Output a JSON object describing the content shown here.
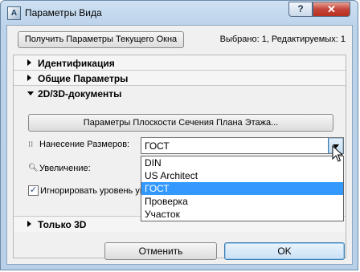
{
  "window": {
    "title": "Параметры Вида",
    "help_label": "?",
    "close_label": "✕"
  },
  "topbar": {
    "get_params_label": "Получить Параметры Текущего Окна",
    "status": "Выбрано: 1, Редактируемых: 1"
  },
  "sections": {
    "identification": "Идентификация",
    "general": "Общие Параметры",
    "docs2d3d": "2D/3D-документы",
    "only3d": "Только 3D"
  },
  "docs": {
    "section_plane_button": "Параметры Плоскости Сечения Плана Этажа...",
    "dimensioning_label": "Нанесение Размеров:",
    "dimensioning_value": "ГОСТ",
    "zoom_label": "Увеличение:",
    "ignore_label": "Игнорировать уровень уве",
    "ignore_checked": true
  },
  "dropdown": {
    "options": [
      "DIN",
      "US Architect",
      "ГОСТ",
      "Проверка",
      "Участок"
    ],
    "selected": "ГОСТ"
  },
  "buttons": {
    "cancel": "Отменить",
    "ok": "OK"
  },
  "colors": {
    "selection": "#3399ff",
    "title_bg": "#bcd3ea",
    "close": "#c4443a"
  }
}
